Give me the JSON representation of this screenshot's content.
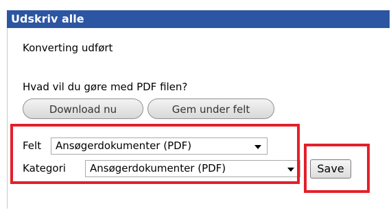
{
  "dialog": {
    "title": "Udskriv alle",
    "status_text": "Konverting udført",
    "question": "Hvad vil du gøre med PDF filen?",
    "buttons": {
      "download_label": "Download nu",
      "save_in_field_label": "Gem under felt"
    },
    "form": {
      "felt_label": "Felt",
      "felt_value": "Ansøgerdokumenter (PDF)",
      "kategori_label": "Kategori",
      "kategori_value": "Ansøgerdokumenter (PDF)",
      "save_label": "Save"
    }
  },
  "colors": {
    "titlebar": "#2c56a1",
    "highlight": "#e3202a"
  }
}
